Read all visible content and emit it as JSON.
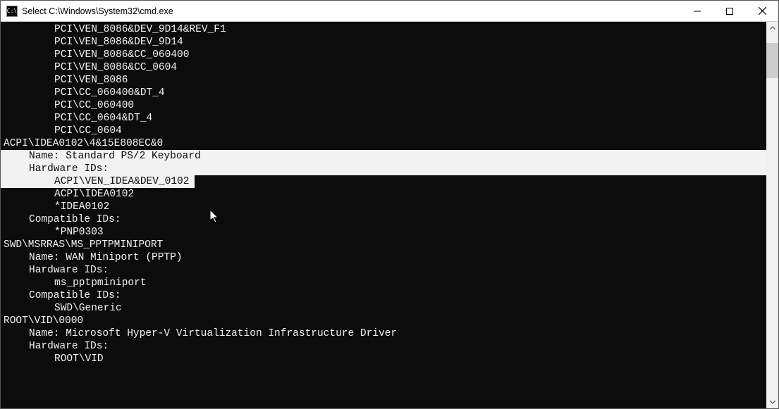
{
  "window": {
    "title": "Select C:\\Windows\\System32\\cmd.exe",
    "icon_label": "C:\\"
  },
  "terminal": {
    "lines": [
      {
        "text": "PCI\\VEN_8086&DEV_9D14&REV_F1",
        "indent": "indent2",
        "sel": false
      },
      {
        "text": "PCI\\VEN_8086&DEV_9D14",
        "indent": "indent2",
        "sel": false
      },
      {
        "text": "PCI\\VEN_8086&CC_060400",
        "indent": "indent2",
        "sel": false
      },
      {
        "text": "PCI\\VEN_8086&CC_0604",
        "indent": "indent2",
        "sel": false
      },
      {
        "text": "PCI\\VEN_8086",
        "indent": "indent2",
        "sel": false
      },
      {
        "text": "PCI\\CC_060400&DT_4",
        "indent": "indent2",
        "sel": false
      },
      {
        "text": "PCI\\CC_060400",
        "indent": "indent2",
        "sel": false
      },
      {
        "text": "PCI\\CC_0604&DT_4",
        "indent": "indent2",
        "sel": false
      },
      {
        "text": "PCI\\CC_0604",
        "indent": "indent2",
        "sel": false
      },
      {
        "text": "ACPI\\IDEA0102\\4&15E808EC&0",
        "indent": "indent3",
        "sel": false
      },
      {
        "text": "Name: Standard PS/2 Keyboard",
        "indent": "indent1",
        "sel": true
      },
      {
        "text": "Hardware IDs:",
        "indent": "indent1",
        "sel": true
      },
      {
        "text": "ACPI\\VEN_IDEA&DEV_0102",
        "indent": "indent2",
        "sel": "partial"
      },
      {
        "text": "ACPI\\IDEA0102",
        "indent": "indent2",
        "sel": false
      },
      {
        "text": "*IDEA0102",
        "indent": "indent2",
        "sel": false
      },
      {
        "text": "Compatible IDs:",
        "indent": "indent1",
        "sel": false
      },
      {
        "text": "*PNP0303",
        "indent": "indent2",
        "sel": false
      },
      {
        "text": "SWD\\MSRRAS\\MS_PPTPMINIPORT",
        "indent": "indent3",
        "sel": false
      },
      {
        "text": "Name: WAN Miniport (PPTP)",
        "indent": "indent1",
        "sel": false
      },
      {
        "text": "Hardware IDs:",
        "indent": "indent1",
        "sel": false
      },
      {
        "text": "ms_pptpminiport",
        "indent": "indent2",
        "sel": false
      },
      {
        "text": "Compatible IDs:",
        "indent": "indent1",
        "sel": false
      },
      {
        "text": "SWD\\Generic",
        "indent": "indent2",
        "sel": false
      },
      {
        "text": "ROOT\\VID\\0000",
        "indent": "indent3",
        "sel": false
      },
      {
        "text": "Name: Microsoft Hyper-V Virtualization Infrastructure Driver",
        "indent": "indent1",
        "sel": false
      },
      {
        "text": "Hardware IDs:",
        "indent": "indent1",
        "sel": false
      },
      {
        "text": "ROOT\\VID",
        "indent": "indent2",
        "sel": false
      }
    ]
  }
}
